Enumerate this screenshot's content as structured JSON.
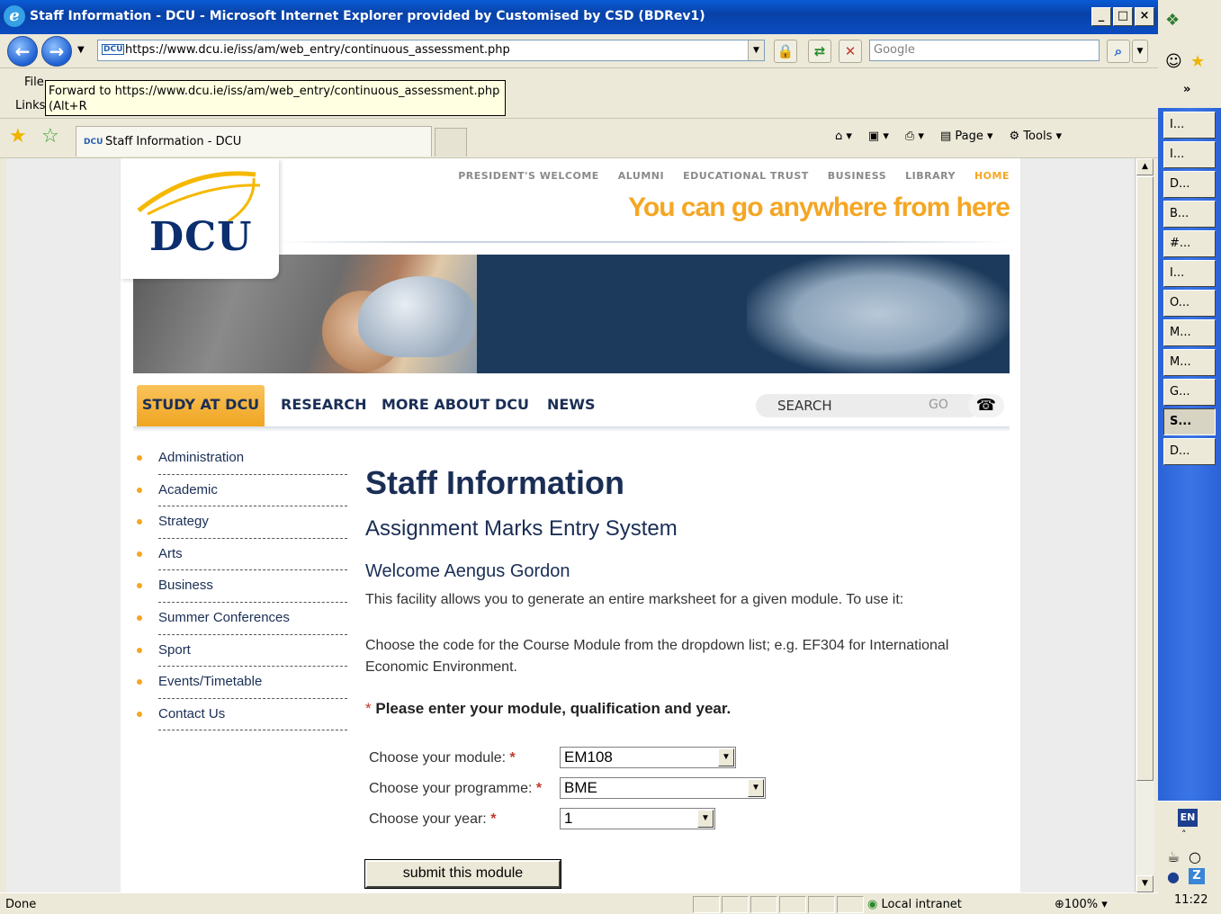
{
  "window": {
    "title": "Staff Information - DCU - Microsoft Internet Explorer provided by Customised by CSD (BDRev1)",
    "minimize": "_",
    "maximize": "□",
    "close": "×"
  },
  "address_bar": {
    "url": "https://www.dcu.ie/iss/am/web_entry/continuous_assessment.php",
    "search_placeholder": "Google",
    "favicon": "DCU"
  },
  "menu": {
    "file": "File",
    "links": "Links",
    "tooltip": "Forward to https://www.dcu.ie/iss/am/web_entry/continuous_assessment.php (Alt+R"
  },
  "tab": {
    "favicon": "DCU",
    "title": "Staff Information - DCU"
  },
  "command_bar": {
    "page": "Page",
    "tools": "Tools"
  },
  "site": {
    "logo": "DCU",
    "top_links": [
      "PRESIDENT'S WELCOME",
      "ALUMNI",
      "EDUCATIONAL TRUST",
      "BUSINESS",
      "LIBRARY",
      "HOME"
    ],
    "tagline": "You can go anywhere from here",
    "main_nav": [
      "STUDY AT DCU",
      "RESEARCH",
      "MORE ABOUT DCU",
      "NEWS"
    ],
    "search": {
      "label": "SEARCH",
      "go": "GO"
    },
    "sidebar": [
      "Administration",
      "Academic",
      "Strategy",
      "Arts",
      "Business",
      "Summer Conferences",
      "Sport",
      "Events/Timetable",
      "Contact Us"
    ]
  },
  "content": {
    "title": "Staff Information",
    "subtitle": "Assignment Marks Entry System",
    "welcome": "Welcome Aengus Gordon",
    "intro": "This facility allows you to generate an entire marksheet for a given module. To use it:",
    "instruction": "Choose the code for the Course Module from the dropdown list; e.g. EF304 for International Economic Environment.",
    "required_note": "Please enter your module, qualification and year.",
    "asterisk": "*",
    "form": {
      "module_label": "Choose your module:",
      "module_value": "EM108",
      "programme_label": "Choose your programme:",
      "programme_value": "BME",
      "year_label": "Choose your year:",
      "year_value": "1",
      "submit": "submit this module"
    }
  },
  "status_bar": {
    "status": "Done",
    "zone": "Local intranet",
    "zoom": "100%"
  },
  "taskbar": {
    "buttons": [
      "I...",
      "I...",
      "D...",
      "B...",
      "#...",
      "I...",
      "O...",
      "M...",
      "M...",
      "G...",
      "S...",
      "D..."
    ],
    "active_index": 10,
    "language": "EN",
    "clock": "11:22"
  },
  "colors": {
    "accent_orange": "#f5a623",
    "dcu_navy": "#1a2e55",
    "xp_blue": "#0a4cc0"
  }
}
